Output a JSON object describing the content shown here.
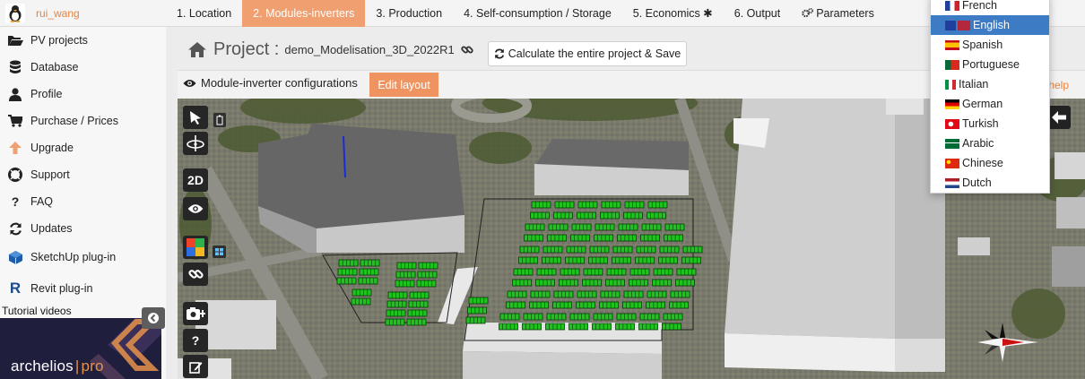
{
  "user": {
    "name": "rui_wang",
    "avatar_icon": "penguin-logo-icon"
  },
  "tabs": [
    {
      "label": "1. Location",
      "active": false
    },
    {
      "label": "2. Modules-inverters",
      "active": true
    },
    {
      "label": "3. Production",
      "active": false
    },
    {
      "label": "4. Self-consumption / Storage",
      "active": false
    },
    {
      "label": "5. Economics",
      "glyph": "✱",
      "active": false
    },
    {
      "label": "6. Output",
      "active": false
    },
    {
      "label": "Parameters",
      "icon": "gears-icon",
      "active": false
    }
  ],
  "sidebar": {
    "items": [
      {
        "label": "PV projects",
        "icon": "folder-open-icon"
      },
      {
        "label": "Database",
        "icon": "database-icon"
      },
      {
        "label": "Profile",
        "icon": "user-icon"
      },
      {
        "label": "Purchase / Prices",
        "icon": "cart-icon"
      },
      {
        "label": "Upgrade",
        "icon": "arrow-up-icon"
      },
      {
        "label": "Support",
        "icon": "lifebuoy-icon"
      },
      {
        "label": "FAQ",
        "icon": "question-icon"
      },
      {
        "label": "Updates",
        "icon": "refresh-icon"
      },
      {
        "label": "SketchUp plug-in",
        "icon": "sketchup-icon"
      },
      {
        "label": "Revit plug-in",
        "icon": "revit-icon"
      }
    ],
    "tutorial_label": "Tutorial videos",
    "tutorial_logo_main": "archelios",
    "tutorial_logo_sep": "|",
    "tutorial_logo_pro": "pro"
  },
  "project": {
    "label": "Project :",
    "name": "demo_Modelisation_3D_2022R1",
    "link_icon": "link-icon"
  },
  "calc_button": {
    "label": "Calculate the entire project & Save",
    "icon": "refresh-icon"
  },
  "config": {
    "title": "Module-inverter configurations",
    "icon": "eye-icon",
    "edit_layout_label": "Edit layout",
    "help_label": "help"
  },
  "toolbar": {
    "two_d_label": "2D",
    "help_label": "?",
    "icons": [
      "cursor-icon",
      "orbit-icon",
      "eye-icon",
      "color-palette-icon",
      "link-icon",
      "camera-plus-icon",
      "edit-icon"
    ]
  },
  "languages": {
    "selected": "English",
    "items": [
      {
        "label": "French",
        "flag": "flag-fr-icon"
      },
      {
        "label": "English",
        "flag": "flag-uk-us-icon",
        "active": true
      },
      {
        "label": "Spanish",
        "flag": "flag-es-icon"
      },
      {
        "label": "Portuguese",
        "flag": "flag-pt-icon"
      },
      {
        "label": "Italian",
        "flag": "flag-it-icon"
      },
      {
        "label": "German",
        "flag": "flag-de-icon"
      },
      {
        "label": "Turkish",
        "flag": "flag-tr-icon"
      },
      {
        "label": "Arabic",
        "flag": "flag-sa-icon"
      },
      {
        "label": "Chinese",
        "flag": "flag-cn-icon"
      },
      {
        "label": "Dutch",
        "flag": "flag-nl-icon"
      }
    ]
  },
  "colors": {
    "accent": "#f0a070",
    "edit_button": "#ef9360",
    "panel_green": "#1fc21f",
    "menu_highlight": "#3d7bc4",
    "toolbar_bg": "#262626"
  }
}
